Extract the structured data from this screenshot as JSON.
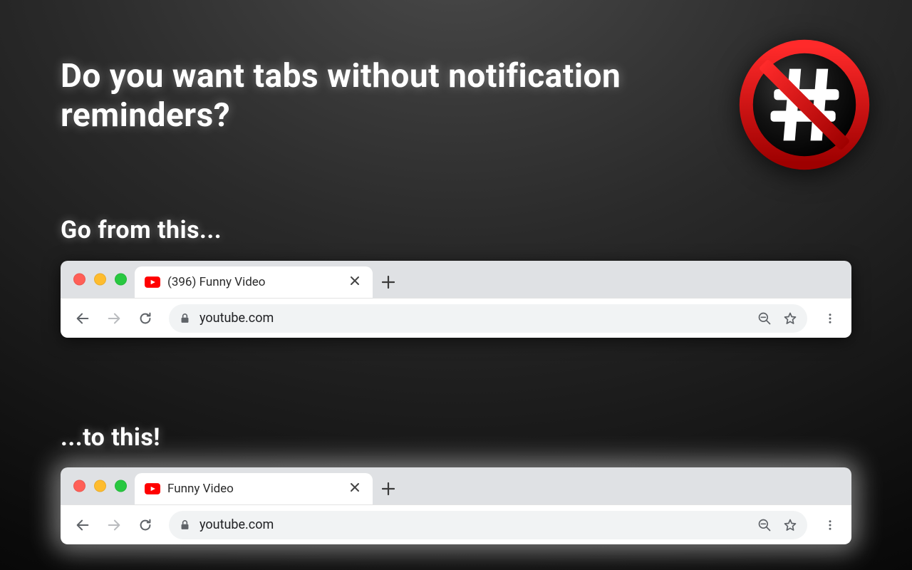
{
  "headline": "Do you want tabs without notification reminders?",
  "subhead_before": "Go from this...",
  "subhead_after": "...to this!",
  "before": {
    "tab_title": "(396) Funny Video",
    "url": "youtube.com"
  },
  "after": {
    "tab_title": "Funny Video",
    "url": "youtube.com"
  },
  "colors": {
    "traffic_red": "#ff5f57",
    "traffic_yellow": "#febc2e",
    "traffic_green": "#28c840",
    "logo_red": "#d40c0c",
    "logo_dark": "#1a1a1a"
  }
}
